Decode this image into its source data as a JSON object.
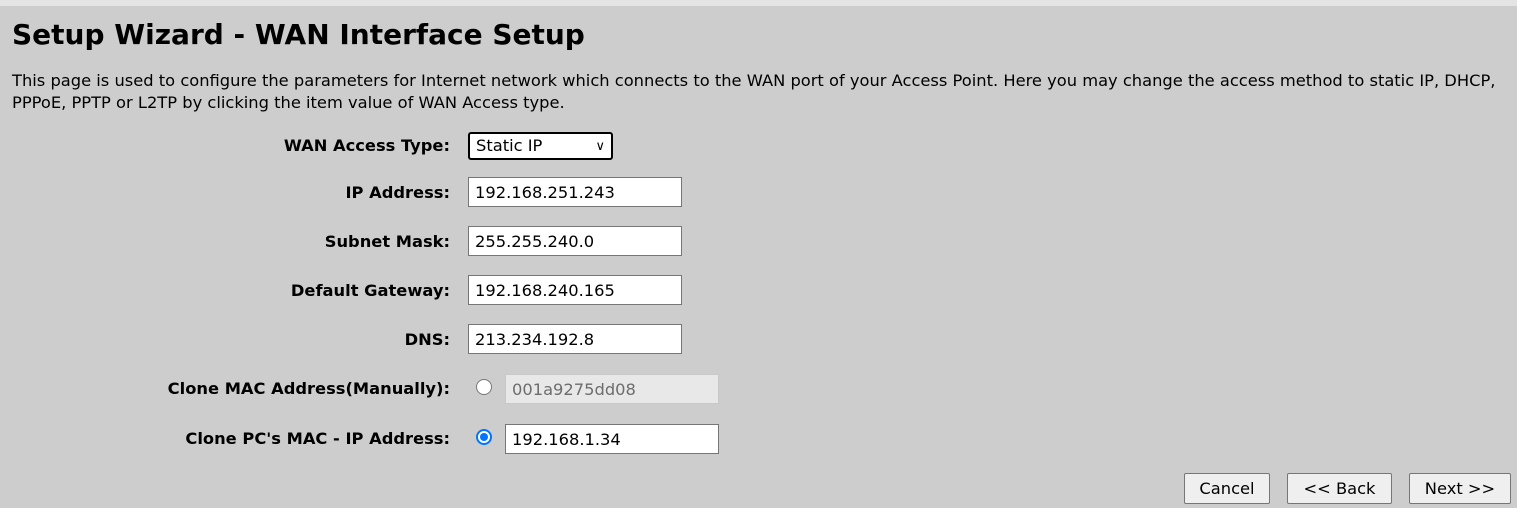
{
  "title": "Setup Wizard - WAN Interface Setup",
  "description": "This page is used to configure the parameters for Internet network which connects to the WAN port of your Access Point. Here you may change the access method to static IP, DHCP, PPPoE, PPTP or L2TP by clicking the item value of WAN Access type.",
  "form": {
    "wan_access_type": {
      "label": "WAN Access Type:",
      "value": "Static IP"
    },
    "ip_address": {
      "label": "IP Address:",
      "value": "192.168.251.243"
    },
    "subnet_mask": {
      "label": "Subnet Mask:",
      "value": "255.255.240.0"
    },
    "default_gateway": {
      "label": "Default Gateway:",
      "value": "192.168.240.165"
    },
    "dns": {
      "label": "DNS:",
      "value": "213.234.192.8"
    },
    "clone_mac_manual": {
      "label": "Clone MAC Address(Manually):",
      "value": "001a9275dd08",
      "selected": false
    },
    "clone_pc_mac": {
      "label": "Clone PC's MAC - IP Address:",
      "value": "192.168.1.34",
      "selected": true
    }
  },
  "buttons": {
    "cancel": "Cancel",
    "back": "<< Back",
    "next": "Next >>"
  },
  "colors": {
    "background": "#cdcdcd",
    "radio_accent": "#0075ff"
  }
}
